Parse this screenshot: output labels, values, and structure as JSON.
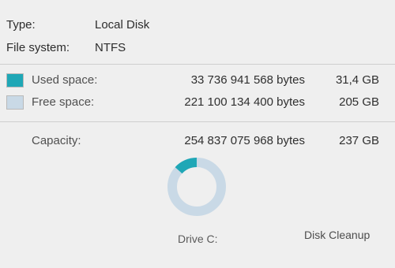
{
  "details": {
    "type_label": "Type:",
    "type_value": "Local Disk",
    "fs_label": "File system:",
    "fs_value": "NTFS"
  },
  "space": {
    "used": {
      "label": "Used space:",
      "bytes": "33 736 941 568 bytes",
      "size": "31,4 GB",
      "color": "#1fa7b6"
    },
    "free": {
      "label": "Free space:",
      "bytes": "221 100 134 400 bytes",
      "size": "205 GB",
      "color": "#c9d9e6"
    },
    "capacity": {
      "label": "Capacity:",
      "bytes": "254 837 075 968 bytes",
      "size": "237 GB"
    }
  },
  "chart": {
    "used_fraction": 0.1324,
    "used_color": "#1fa7b6",
    "free_color": "#c9d9e6"
  },
  "footer": {
    "drive_label": "Drive C:",
    "cleanup_label": "Disk Cleanup"
  }
}
